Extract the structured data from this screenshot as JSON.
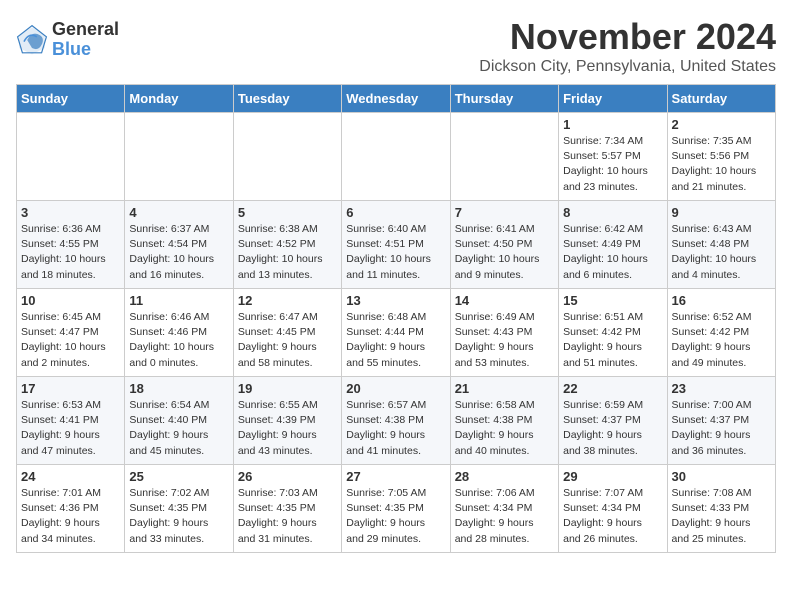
{
  "header": {
    "logo_general": "General",
    "logo_blue": "Blue",
    "month": "November 2024",
    "location": "Dickson City, Pennsylvania, United States"
  },
  "weekdays": [
    "Sunday",
    "Monday",
    "Tuesday",
    "Wednesday",
    "Thursday",
    "Friday",
    "Saturday"
  ],
  "weeks": [
    [
      {
        "day": "",
        "info": ""
      },
      {
        "day": "",
        "info": ""
      },
      {
        "day": "",
        "info": ""
      },
      {
        "day": "",
        "info": ""
      },
      {
        "day": "",
        "info": ""
      },
      {
        "day": "1",
        "info": "Sunrise: 7:34 AM\nSunset: 5:57 PM\nDaylight: 10 hours\nand 23 minutes."
      },
      {
        "day": "2",
        "info": "Sunrise: 7:35 AM\nSunset: 5:56 PM\nDaylight: 10 hours\nand 21 minutes."
      }
    ],
    [
      {
        "day": "3",
        "info": "Sunrise: 6:36 AM\nSunset: 4:55 PM\nDaylight: 10 hours\nand 18 minutes."
      },
      {
        "day": "4",
        "info": "Sunrise: 6:37 AM\nSunset: 4:54 PM\nDaylight: 10 hours\nand 16 minutes."
      },
      {
        "day": "5",
        "info": "Sunrise: 6:38 AM\nSunset: 4:52 PM\nDaylight: 10 hours\nand 13 minutes."
      },
      {
        "day": "6",
        "info": "Sunrise: 6:40 AM\nSunset: 4:51 PM\nDaylight: 10 hours\nand 11 minutes."
      },
      {
        "day": "7",
        "info": "Sunrise: 6:41 AM\nSunset: 4:50 PM\nDaylight: 10 hours\nand 9 minutes."
      },
      {
        "day": "8",
        "info": "Sunrise: 6:42 AM\nSunset: 4:49 PM\nDaylight: 10 hours\nand 6 minutes."
      },
      {
        "day": "9",
        "info": "Sunrise: 6:43 AM\nSunset: 4:48 PM\nDaylight: 10 hours\nand 4 minutes."
      }
    ],
    [
      {
        "day": "10",
        "info": "Sunrise: 6:45 AM\nSunset: 4:47 PM\nDaylight: 10 hours\nand 2 minutes."
      },
      {
        "day": "11",
        "info": "Sunrise: 6:46 AM\nSunset: 4:46 PM\nDaylight: 10 hours\nand 0 minutes."
      },
      {
        "day": "12",
        "info": "Sunrise: 6:47 AM\nSunset: 4:45 PM\nDaylight: 9 hours\nand 58 minutes."
      },
      {
        "day": "13",
        "info": "Sunrise: 6:48 AM\nSunset: 4:44 PM\nDaylight: 9 hours\nand 55 minutes."
      },
      {
        "day": "14",
        "info": "Sunrise: 6:49 AM\nSunset: 4:43 PM\nDaylight: 9 hours\nand 53 minutes."
      },
      {
        "day": "15",
        "info": "Sunrise: 6:51 AM\nSunset: 4:42 PM\nDaylight: 9 hours\nand 51 minutes."
      },
      {
        "day": "16",
        "info": "Sunrise: 6:52 AM\nSunset: 4:42 PM\nDaylight: 9 hours\nand 49 minutes."
      }
    ],
    [
      {
        "day": "17",
        "info": "Sunrise: 6:53 AM\nSunset: 4:41 PM\nDaylight: 9 hours\nand 47 minutes."
      },
      {
        "day": "18",
        "info": "Sunrise: 6:54 AM\nSunset: 4:40 PM\nDaylight: 9 hours\nand 45 minutes."
      },
      {
        "day": "19",
        "info": "Sunrise: 6:55 AM\nSunset: 4:39 PM\nDaylight: 9 hours\nand 43 minutes."
      },
      {
        "day": "20",
        "info": "Sunrise: 6:57 AM\nSunset: 4:38 PM\nDaylight: 9 hours\nand 41 minutes."
      },
      {
        "day": "21",
        "info": "Sunrise: 6:58 AM\nSunset: 4:38 PM\nDaylight: 9 hours\nand 40 minutes."
      },
      {
        "day": "22",
        "info": "Sunrise: 6:59 AM\nSunset: 4:37 PM\nDaylight: 9 hours\nand 38 minutes."
      },
      {
        "day": "23",
        "info": "Sunrise: 7:00 AM\nSunset: 4:37 PM\nDaylight: 9 hours\nand 36 minutes."
      }
    ],
    [
      {
        "day": "24",
        "info": "Sunrise: 7:01 AM\nSunset: 4:36 PM\nDaylight: 9 hours\nand 34 minutes."
      },
      {
        "day": "25",
        "info": "Sunrise: 7:02 AM\nSunset: 4:35 PM\nDaylight: 9 hours\nand 33 minutes."
      },
      {
        "day": "26",
        "info": "Sunrise: 7:03 AM\nSunset: 4:35 PM\nDaylight: 9 hours\nand 31 minutes."
      },
      {
        "day": "27",
        "info": "Sunrise: 7:05 AM\nSunset: 4:35 PM\nDaylight: 9 hours\nand 29 minutes."
      },
      {
        "day": "28",
        "info": "Sunrise: 7:06 AM\nSunset: 4:34 PM\nDaylight: 9 hours\nand 28 minutes."
      },
      {
        "day": "29",
        "info": "Sunrise: 7:07 AM\nSunset: 4:34 PM\nDaylight: 9 hours\nand 26 minutes."
      },
      {
        "day": "30",
        "info": "Sunrise: 7:08 AM\nSunset: 4:33 PM\nDaylight: 9 hours\nand 25 minutes."
      }
    ]
  ]
}
